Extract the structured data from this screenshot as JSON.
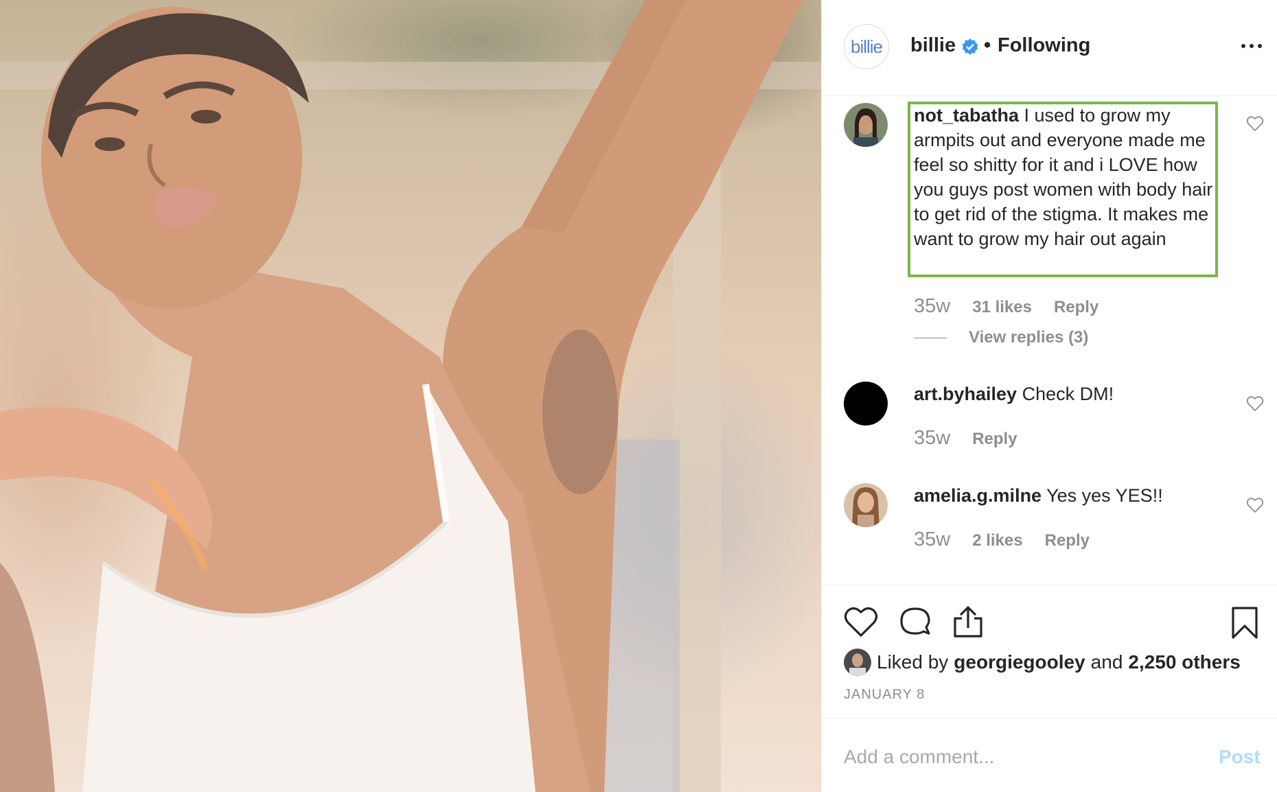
{
  "post": {
    "username": "billie",
    "avatar_text": "billie",
    "separator": "•",
    "follow_status": "Following"
  },
  "comments": [
    {
      "username": "not_tabatha",
      "text": "I used to grow my armpits out and everyone made me feel so shitty for it and i LOVE how you guys post women with body hair to get rid of the stigma. It makes me want to grow my hair out again",
      "time": "35w",
      "likes": "31 likes",
      "reply": "Reply",
      "view_replies": "View replies (3)"
    },
    {
      "username": "art.byhailey",
      "text": "Check DM!",
      "time": "35w",
      "reply": "Reply"
    },
    {
      "username": "amelia.g.milne",
      "text": "Yes yes YES!!",
      "time": "35w",
      "likes": "2 likes",
      "reply": "Reply"
    }
  ],
  "likes": {
    "prefix": "Liked by",
    "user": "georgiegooley",
    "conj": "and",
    "others": "2,250 others"
  },
  "date": "JANUARY 8",
  "add_comment": {
    "placeholder": "Add a comment...",
    "post_label": "Post"
  },
  "colors": {
    "highlight_border": "#7ab648",
    "verified_badge": "#3897f0",
    "post_button": "#b3dbff"
  },
  "icons": [
    "verified-icon",
    "more-icon",
    "heart-icon",
    "comment-icon",
    "share-icon",
    "bookmark-icon"
  ]
}
